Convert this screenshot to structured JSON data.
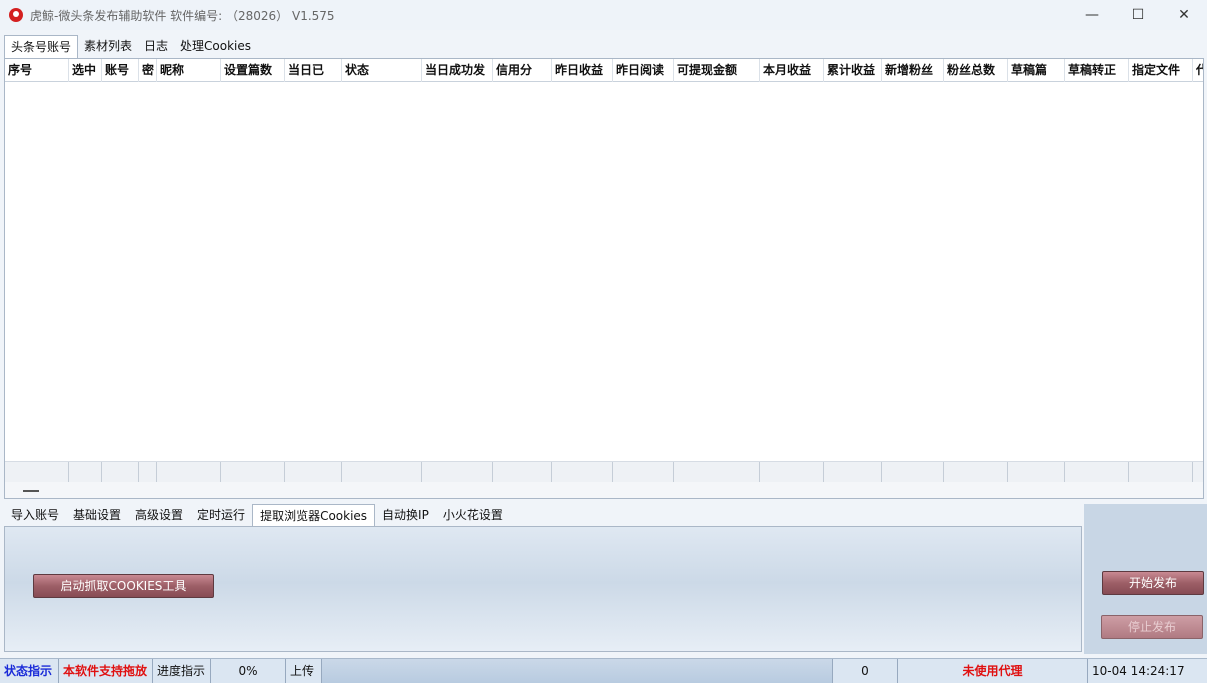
{
  "window": {
    "title": "虎鲸-微头条发布辅助软件 软件编号: （28026） V1.575",
    "minimize": "—",
    "maximize": "☐",
    "close": "✕"
  },
  "top_tabs": [
    "头条号账号",
    "素材列表",
    "日志",
    "处理Cookies"
  ],
  "table": {
    "columns": [
      "序号",
      "选中",
      "账号",
      "密",
      "昵称",
      "设置篇数",
      "当日已",
      "状态",
      "当日成功发",
      "信用分",
      "昨日收益",
      "昨日阅读",
      "可提现金额",
      "本月收益",
      "累计收益",
      "新增粉丝",
      "粉丝总数",
      "草稿篇",
      "草稿转正",
      "指定文件",
      "代"
    ],
    "rows": []
  },
  "scrollbar_thumb": "—",
  "bottom_tabs": [
    "导入账号",
    "基础设置",
    "高级设置",
    "定时运行",
    "提取浏览器Cookies",
    "自动换IP",
    "小火花设置"
  ],
  "panel": {
    "launch_button": "启动抓取COOKIES工具"
  },
  "actions": {
    "start": "开始发布",
    "stop": "停止发布"
  },
  "status": {
    "indicator": "状态指示",
    "drag_support": "本软件支持拖放",
    "progress_label": "进度指示",
    "progress_value": "0%",
    "upload": "上传",
    "count": "0",
    "proxy": "未使用代理",
    "datetime": "10-04  14:24:17"
  },
  "colors": {
    "status_blue": "#1a2bd8",
    "status_red": "#e01010",
    "button_maroon": "#9d5f67"
  }
}
